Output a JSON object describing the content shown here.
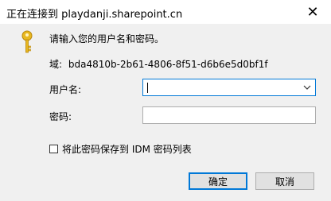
{
  "window": {
    "title": "正在连接到 playdanji.sharepoint.cn",
    "close_glyph": "✕"
  },
  "dialog": {
    "prompt": "请输入您的用户名和密码。",
    "domain_label": "域:",
    "domain_value": "bda4810b-2b61-4806-8f51-d6b6e5d0bf1f",
    "username_label": "用户名:",
    "username_value": "",
    "password_label": "密码:",
    "password_value": "",
    "save_checkbox_label": "将此密码保存到 IDM 密码列表",
    "save_checked": false
  },
  "buttons": {
    "ok": "确定",
    "cancel": "取消"
  },
  "colors": {
    "accent": "#0078d7",
    "key_gold": "#e8b820"
  }
}
